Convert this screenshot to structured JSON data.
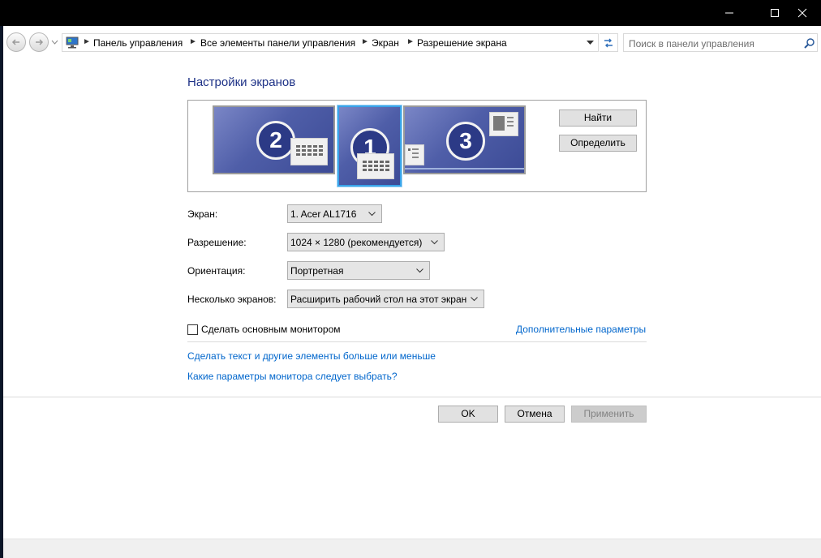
{
  "window": {
    "minimize_icon": "minimize-icon",
    "maximize_icon": "maximize-icon",
    "close_icon": "close-icon"
  },
  "address_bar": {
    "crumbs": [
      "Панель управления",
      "Все элементы панели управления",
      "Экран",
      "Разрешение экрана"
    ]
  },
  "search": {
    "placeholder": "Поиск в панели управления"
  },
  "heading": "Настройки экранов",
  "monitors": [
    {
      "label": "2"
    },
    {
      "label": "1",
      "selected": true
    },
    {
      "label": "3"
    }
  ],
  "buttons": {
    "find": "Найти",
    "identify": "Определить",
    "ok": "OK",
    "cancel": "Отмена",
    "apply": "Применить"
  },
  "fields": {
    "screen": {
      "label": "Экран:",
      "value": "1. Acer AL1716"
    },
    "resolution": {
      "label": "Разрешение:",
      "value": "1024 × 1280 (рекомендуется)"
    },
    "orientation": {
      "label": "Ориентация:",
      "value": "Портретная"
    },
    "multiple": {
      "label": "Несколько экранов:",
      "value": "Расширить рабочий стол на этот экран"
    }
  },
  "primary_checkbox": {
    "label": "Сделать основным монитором",
    "checked": false
  },
  "links": {
    "advanced": "Дополнительные параметры",
    "text_size": "Сделать текст и другие элементы больше или меньше",
    "which_settings": "Какие параметры монитора следует выбрать?"
  },
  "colors": {
    "heading": "#1e3287",
    "link": "#0066cc",
    "selection": "#39a3e8"
  }
}
